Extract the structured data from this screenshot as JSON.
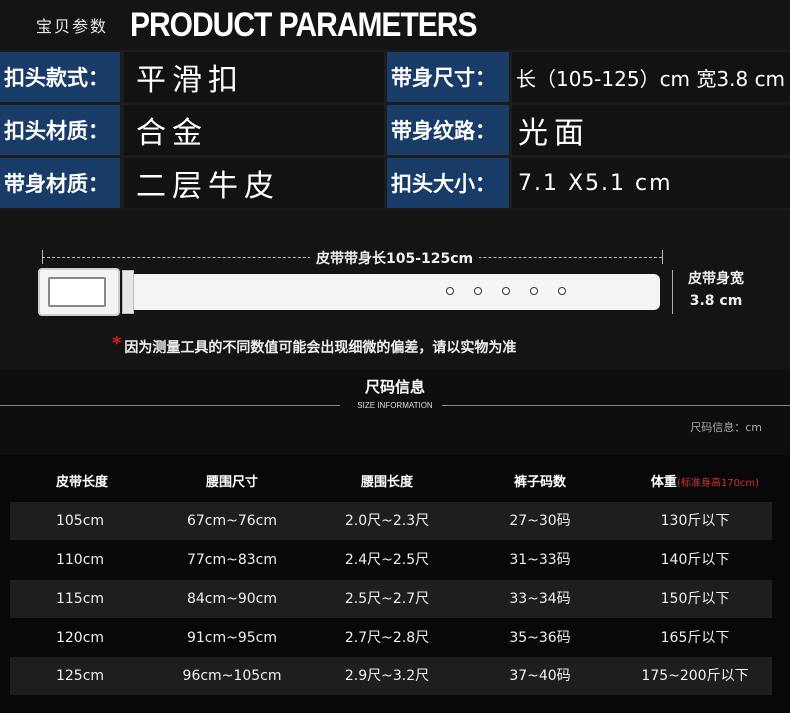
{
  "header": {
    "title_cn": "宝贝参数",
    "title_en": "PRODUCT PARAMETERS"
  },
  "params": [
    {
      "label": "扣头款式：",
      "value": "平滑扣"
    },
    {
      "label": "带身尺寸：",
      "value": "长（105-125）cm 宽3.8 cm"
    },
    {
      "label": "扣头材质：",
      "value": "合金"
    },
    {
      "label": "带身纹路：",
      "value": "光面"
    },
    {
      "label": "带身材质：",
      "value": "二层牛皮"
    },
    {
      "label": "扣头大小：",
      "value": "7.1 X5.1 cm"
    }
  ],
  "diagram": {
    "length_label": "皮带带身长105-125cm",
    "width_label_1": "皮带身宽",
    "width_label_2": "3.8 cm",
    "note_star": "*",
    "note": "因为测量工具的不同数值可能会出现细微的偏差，请以实物为准"
  },
  "size_info": {
    "title": "尺码信息",
    "subtitle": "SIZE INFORMATION",
    "unit_note": "尺码信息：cm"
  },
  "table": {
    "headers": [
      "皮带长度",
      "腰围尺寸",
      "腰围长度",
      "裤子码数",
      "体重"
    ],
    "header_note": "(标准身高170cm)",
    "rows": [
      [
        "105cm",
        "67cm~76cm",
        "2.0尺~2.3尺",
        "27~30码",
        "130斤以下"
      ],
      [
        "110cm",
        "77cm~83cm",
        "2.4尺~2.5尺",
        "31~33码",
        "140斤以下"
      ],
      [
        "115cm",
        "84cm~90cm",
        "2.5尺~2.7尺",
        "33~34码",
        "150斤以下"
      ],
      [
        "120cm",
        "91cm~95cm",
        "2.7尺~2.8尺",
        "35~36码",
        "165斤以下"
      ],
      [
        "125cm",
        "96cm~105cm",
        "2.9尺~3.2尺",
        "37~40码",
        "175~200斤以下"
      ]
    ]
  }
}
